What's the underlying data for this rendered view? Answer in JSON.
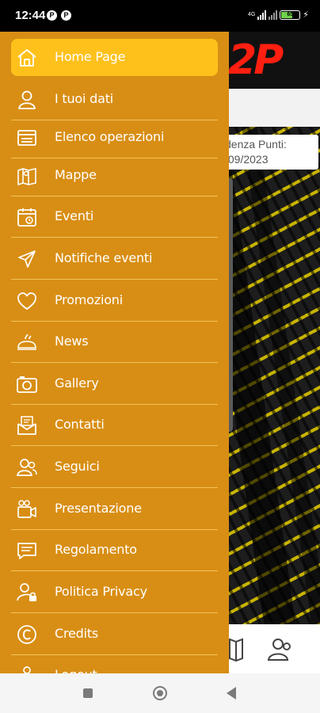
{
  "status_bar": {
    "time": "12:44",
    "notification_badges": [
      "P",
      "P"
    ],
    "network_type": "4G",
    "battery_level": "65",
    "charging": true
  },
  "background_app": {
    "logo_text": "2P",
    "card_text_line1": "denza Punti:",
    "card_text_line2": "/09/2023",
    "brand_color": "#ff1f10"
  },
  "drawer": {
    "background_color": "#d88e14",
    "active_color": "#fec11c",
    "items": [
      {
        "label": "Home Page",
        "icon": "home-icon",
        "active": true
      },
      {
        "label": "I tuoi dati",
        "icon": "user-icon",
        "active": false
      },
      {
        "label": "Elenco operazioni",
        "icon": "list-card-icon",
        "active": false
      },
      {
        "label": "Mappe",
        "icon": "map-icon",
        "active": false
      },
      {
        "label": "Eventi",
        "icon": "calendar-icon",
        "active": false
      },
      {
        "label": "Notifiche eventi",
        "icon": "send-icon",
        "active": false
      },
      {
        "label": "Promozioni",
        "icon": "heart-icon",
        "active": false
      },
      {
        "label": "News",
        "icon": "news-icon",
        "active": false
      },
      {
        "label": "Gallery",
        "icon": "camera-icon",
        "active": false
      },
      {
        "label": "Contatti",
        "icon": "contact-mail-icon",
        "active": false
      },
      {
        "label": "Seguici",
        "icon": "users-icon",
        "active": false
      },
      {
        "label": "Presentazione",
        "icon": "video-camera-icon",
        "active": false
      },
      {
        "label": "Regolamento",
        "icon": "message-icon",
        "active": false
      },
      {
        "label": "Politica Privacy",
        "icon": "user-lock-icon",
        "active": false
      },
      {
        "label": "Credits",
        "icon": "copyright-icon",
        "active": false
      },
      {
        "label": "Logout",
        "icon": "logout-icon",
        "active": false
      }
    ]
  },
  "nav_bar": {
    "buttons": [
      "recents-icon",
      "home-circle-icon",
      "back-icon"
    ]
  }
}
